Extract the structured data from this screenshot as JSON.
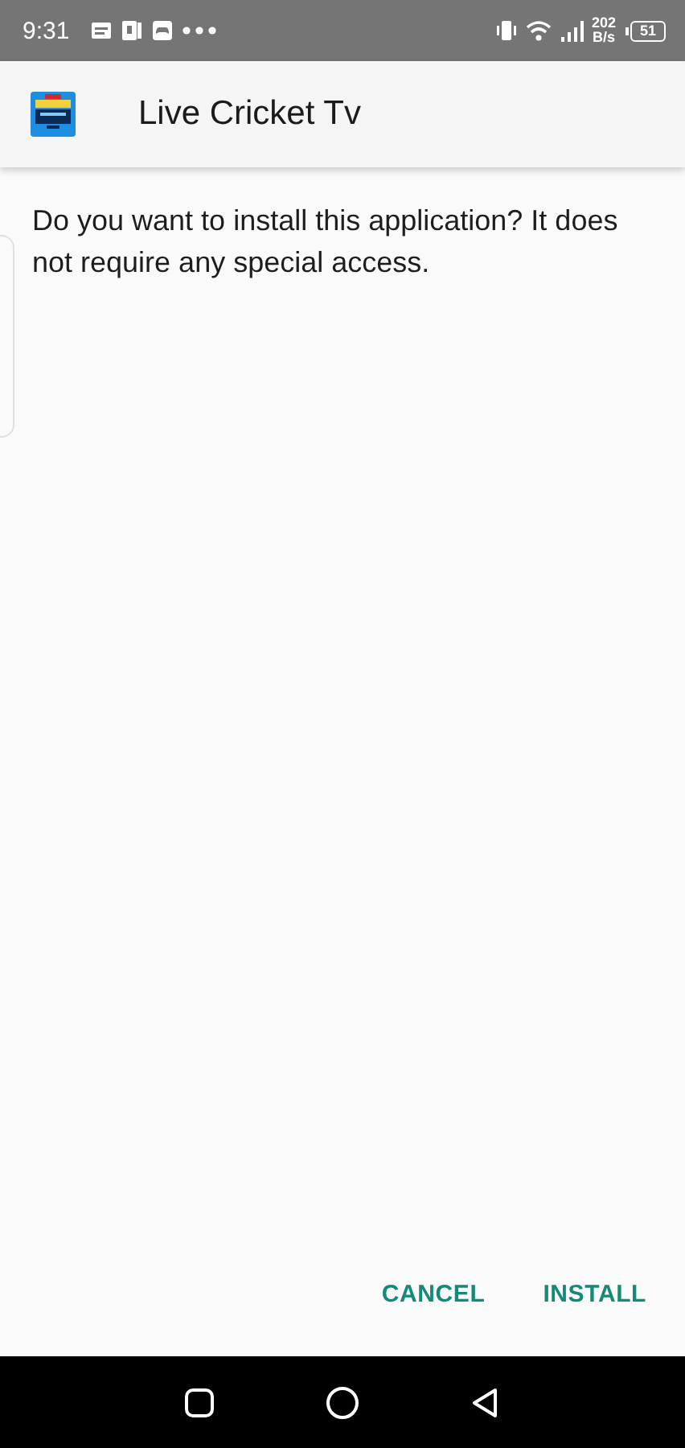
{
  "status_bar": {
    "time": "9:31",
    "network_speed": "202",
    "network_unit": "B/s",
    "battery": "51"
  },
  "app_bar": {
    "title": "Live Cricket Tv"
  },
  "message": "Do you want to install this application? It does not require any special access.",
  "buttons": [
    {
      "label": "CANCEL"
    },
    {
      "label": "INSTALL"
    }
  ]
}
